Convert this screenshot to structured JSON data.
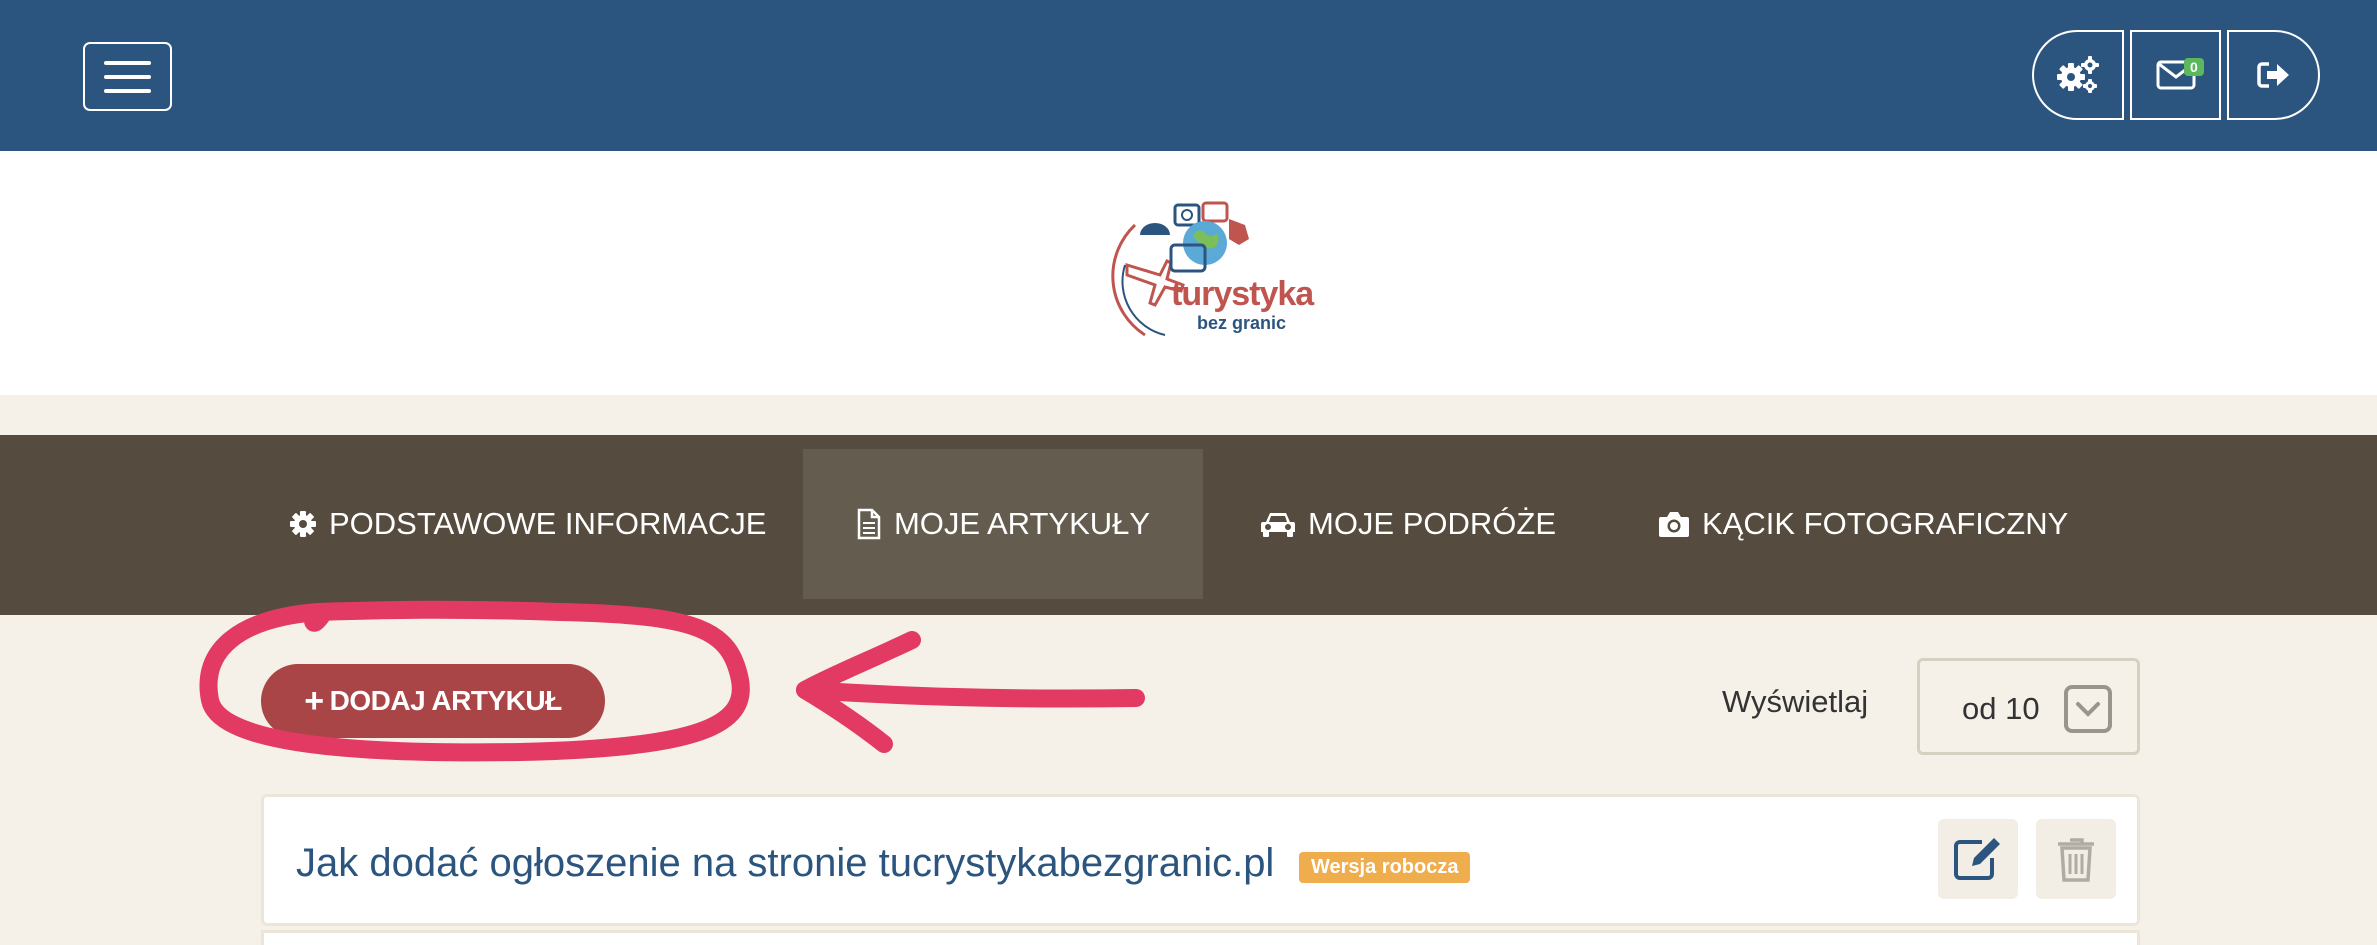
{
  "header": {
    "menu_icon": "hamburger-icon",
    "tools": {
      "settings_icon": "cogs-icon",
      "mail_icon": "envelope-icon",
      "mail_count": "0",
      "logout_icon": "sign-out-icon"
    },
    "colors": {
      "bar": "#2b557e"
    }
  },
  "logo": {
    "word": "turystyka",
    "sub": "bez granic"
  },
  "nav": {
    "items": [
      {
        "label": "PODSTAWOWE INFORMACJE",
        "icon": "gear-icon",
        "active": false
      },
      {
        "label": "MOJE ARTYKUŁY",
        "icon": "file-text-icon",
        "active": true
      },
      {
        "label": "MOJE PODRÓŻE",
        "icon": "car-icon",
        "active": false
      },
      {
        "label": "KĄCIK FOTOGRAFICZNY",
        "icon": "camera-icon",
        "active": false
      }
    ],
    "colors": {
      "bar": "#554b3e",
      "active": "#645d4f"
    }
  },
  "actions": {
    "add_article_label": "DODAJ ARTYKUŁ",
    "add_article_icon": "plus-icon",
    "show_label": "Wyświetlaj",
    "per_page_value": "od 10",
    "button_color": "#a94447",
    "annotation_color": "#e23a62"
  },
  "articles": [
    {
      "title": "Jak dodać ogłoszenie na stronie tucrystykabezgranic.pl",
      "status": "Wersja robocza",
      "edit_icon": "edit-icon",
      "delete_icon": "trash-icon"
    }
  ]
}
